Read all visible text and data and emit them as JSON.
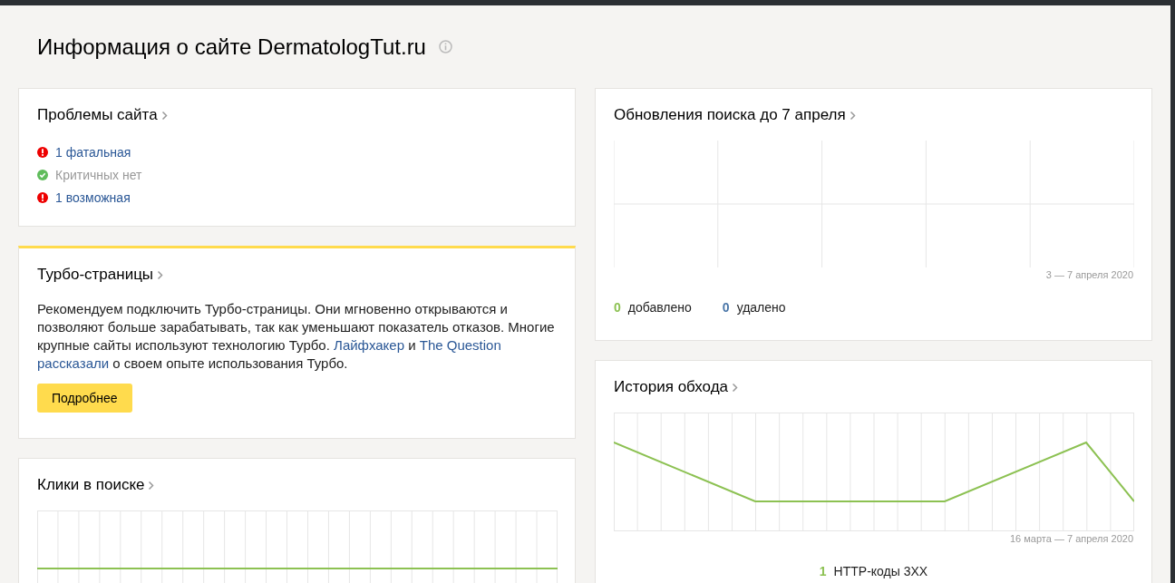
{
  "page": {
    "title": "Информация о сайте DermatologTut.ru"
  },
  "problems": {
    "title": "Проблемы сайта",
    "items": [
      {
        "kind": "error",
        "text": "1 фатальная"
      },
      {
        "kind": "ok",
        "text": "Критичных нет"
      },
      {
        "kind": "error",
        "text": "1 возможная"
      }
    ]
  },
  "turbo": {
    "title": "Турбо-страницы",
    "parts": [
      {
        "kind": "text",
        "text": "Рекомендуем подключить Турбо-страницы. Они мгновенно открываются и позволяют больше зарабатывать, так как уменьшают показатель отказов. Многие крупные сайты используют технологию Турбо. "
      },
      {
        "kind": "link",
        "text": "Лайфхакер"
      },
      {
        "kind": "text",
        "text": " и "
      },
      {
        "kind": "link",
        "text": "The Question"
      },
      {
        "kind": "link",
        "text": "рассказали"
      },
      {
        "kind": "text",
        "text": " о своем опыте использования Турбо."
      }
    ],
    "button": "Подробнее"
  },
  "clicks": {
    "title": "Клики в поиске"
  },
  "updates": {
    "title": "Обновления поиска до 7 апреля",
    "period": "3 — 7 апреля 2020",
    "stats": [
      {
        "value": "0",
        "label": "добавлено",
        "color": "#8cc152"
      },
      {
        "value": "0",
        "label": "удалено",
        "color": "#4a76a8"
      }
    ]
  },
  "history": {
    "title": "История обхода",
    "period": "16 марта — 7 апреля 2020",
    "legend": [
      {
        "value": "1",
        "label": "HTTP-коды 3XX",
        "color": "#8cc152"
      }
    ]
  }
}
